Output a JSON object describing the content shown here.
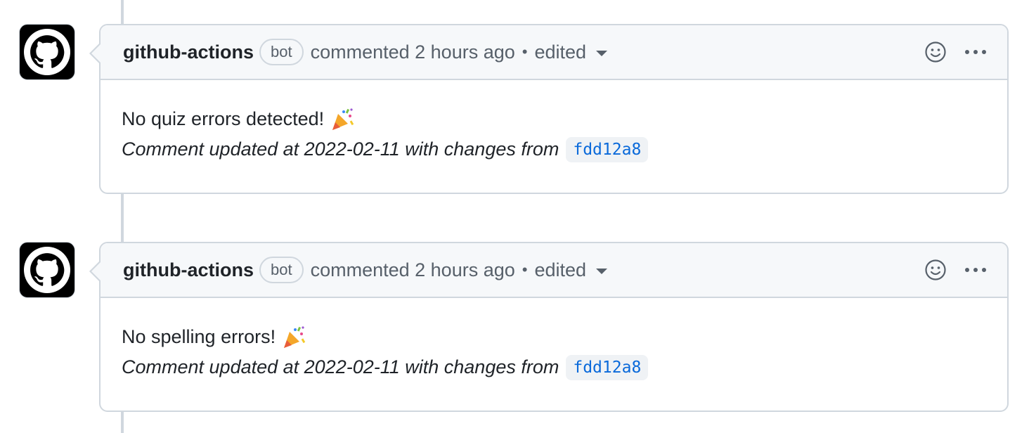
{
  "comments": [
    {
      "author": "github-actions",
      "badge": "bot",
      "action": "commented 2 hours ago",
      "separator": "•",
      "edited_label": "edited",
      "message": "No quiz errors detected!",
      "message_icon": "party-popper-icon",
      "update_text": "Comment updated at 2022-02-11 with changes from",
      "commit_sha": "fdd12a8"
    },
    {
      "author": "github-actions",
      "badge": "bot",
      "action": "commented 2 hours ago",
      "separator": "•",
      "edited_label": "edited",
      "message": "No spelling errors!",
      "message_icon": "party-popper-icon",
      "update_text": "Comment updated at 2022-02-11 with changes from",
      "commit_sha": "fdd12a8"
    }
  ],
  "colors": {
    "header_bg": "#f6f8fa",
    "border": "#d0d7de",
    "link": "#0969da",
    "muted": "#57606a"
  }
}
